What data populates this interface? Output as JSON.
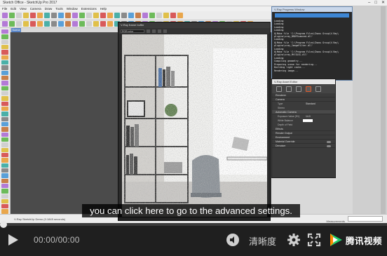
{
  "app": {
    "title": "Sketch Office - SketchUp Pro 2017",
    "menu": [
      "File",
      "Edit",
      "View",
      "Camera",
      "Draw",
      "Tools",
      "Window",
      "Extensions",
      "Help"
    ],
    "scene_tab": "Scene 1",
    "status_text": "V-Ray SketchUp Demo (0.1845 seconds)",
    "measurements_label": "Measurements"
  },
  "frame_buffer": {
    "title": "V-Ray frame buffer",
    "channel": "RGB color"
  },
  "log_window": {
    "title": "V-Ray Progress Window",
    "lines": [
      "Loading",
      "Loading",
      "Loading",
      "Loading",
      "0|Mdne file 'C:\\Program Files\\Chaos Group\\V-Ray\\",
      "plugins\\vray_BRDFScanned.dll'",
      "Loading",
      "0|Mdne file 'C:\\Program Files\\Chaos Group\\V-Ray\\",
      "plugins\\vray_ImageFilter.dll'",
      "Loading",
      "0|Mdne file 'C:\\Program Files\\Chaos Group\\V-Ray\\",
      "plugins\\vray_MtlGLSL.dll'",
      "Loading",
      "Compiling geometry...",
      "Preparing scene for rendering...",
      "Building light cache...",
      "Rendering image..."
    ]
  },
  "asset_editor": {
    "title": "V-Ray Asset Editor",
    "rows": [
      {
        "type": "section",
        "label": "Renderer",
        "toggle": false
      },
      {
        "type": "section",
        "label": "Camera",
        "toggle": false
      },
      {
        "type": "row",
        "label": "Type",
        "value": "Standard"
      },
      {
        "type": "row",
        "label": "Stereo",
        "value": ""
      },
      {
        "type": "section",
        "label": "Automatic Camera",
        "toggle": false
      },
      {
        "type": "row",
        "label": "Exposure Value (EV)",
        "value": "14.0"
      },
      {
        "type": "row",
        "label": "White Balance",
        "value": ""
      },
      {
        "type": "row",
        "label": "Depth of Field",
        "value": ""
      },
      {
        "type": "section",
        "label": "Effects",
        "toggle": false
      },
      {
        "type": "section",
        "label": "Render Output",
        "toggle": false
      },
      {
        "type": "section",
        "label": "Environment",
        "toggle": false
      },
      {
        "type": "section",
        "label": "Material Override",
        "toggle": true
      },
      {
        "type": "section",
        "label": "Denoiser",
        "toggle": true
      }
    ]
  },
  "subtitle": "you can click here to go to the advanced settings.",
  "player": {
    "time": "00:00/00:00",
    "quality_label": "清晰度",
    "brand": "腾讯视频",
    "progress": 0
  },
  "icons": {
    "play": "play-icon",
    "volume": "volume-icon",
    "settings": "gear-icon",
    "fullscreen": "fullscreen-icon",
    "logo": "tencent-video-logo"
  },
  "colors": {
    "accent_blue": "#3d86d4",
    "player_bg": "#1f1f1f",
    "brand_green": "#1fcc6a",
    "brand_orange": "#ff8a00"
  }
}
